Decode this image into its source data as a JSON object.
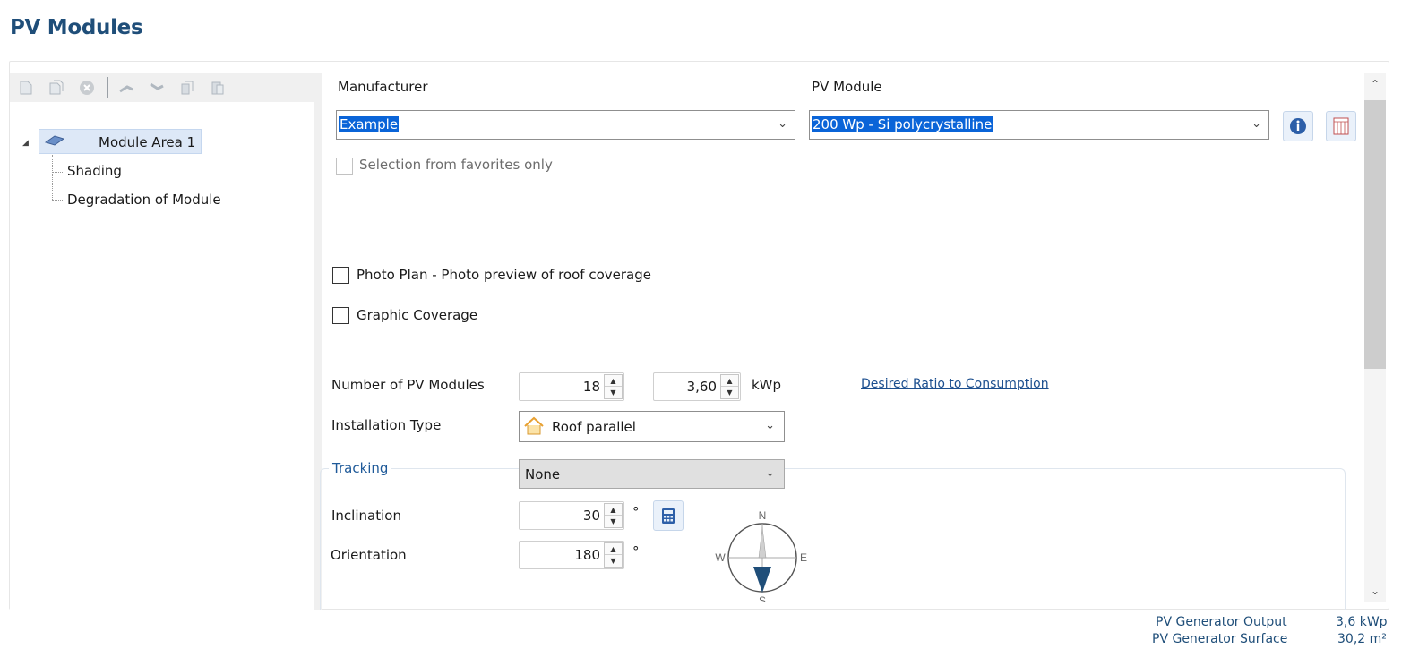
{
  "page": {
    "title": "PV Modules"
  },
  "tree": {
    "toolbar_icons": [
      "new-document-icon",
      "copy-document-icon",
      "delete-icon",
      "move-up-icon",
      "move-down-icon",
      "copy-icon",
      "paste-icon"
    ],
    "root": {
      "label": "Module Area 1",
      "icon": "pv-module-icon",
      "expanded": true
    },
    "children": [
      "Shading",
      "Degradation of Module"
    ]
  },
  "module_selection": {
    "manufacturer_label": "Manufacturer",
    "manufacturer_value": "Example",
    "pv_module_label": "PV Module",
    "pv_module_value": "200 Wp - Si polycrystalline",
    "favorites_label": "Selection from favorites only",
    "favorites_checked": false
  },
  "options": {
    "photo_plan_label": "Photo Plan - Photo preview of roof coverage",
    "photo_plan_checked": false,
    "graphic_coverage_label": "Graphic Coverage",
    "graphic_coverage_checked": false
  },
  "config": {
    "num_modules_label": "Number of PV Modules",
    "num_modules_value": "18",
    "kwp_value": "3,60",
    "kwp_unit": "kWp",
    "desired_ratio_link": "Desired Ratio to Consumption",
    "installation_type_label": "Installation Type",
    "installation_type_value": "Roof parallel",
    "installation_type_icon": "house-icon"
  },
  "tracking": {
    "group_label": "Tracking",
    "tracking_value": "None",
    "inclination_label": "Inclination",
    "inclination_value": "30",
    "inclination_unit": "°",
    "orientation_label": "Orientation",
    "orientation_value": "180",
    "orientation_unit": "°",
    "compass": {
      "n": "N",
      "e": "E",
      "s": "S",
      "w": "W",
      "needle_degrees": 180
    }
  },
  "footer": {
    "output_label": "PV Generator Output",
    "output_value": "3,6 kWp",
    "surface_label": "PV Generator Surface",
    "surface_value": "30,2 m²"
  },
  "colors": {
    "title": "#1f4e79",
    "selection": "#0a64d8",
    "link": "#1c4f8f",
    "compass_needle": "#1f4e79"
  }
}
